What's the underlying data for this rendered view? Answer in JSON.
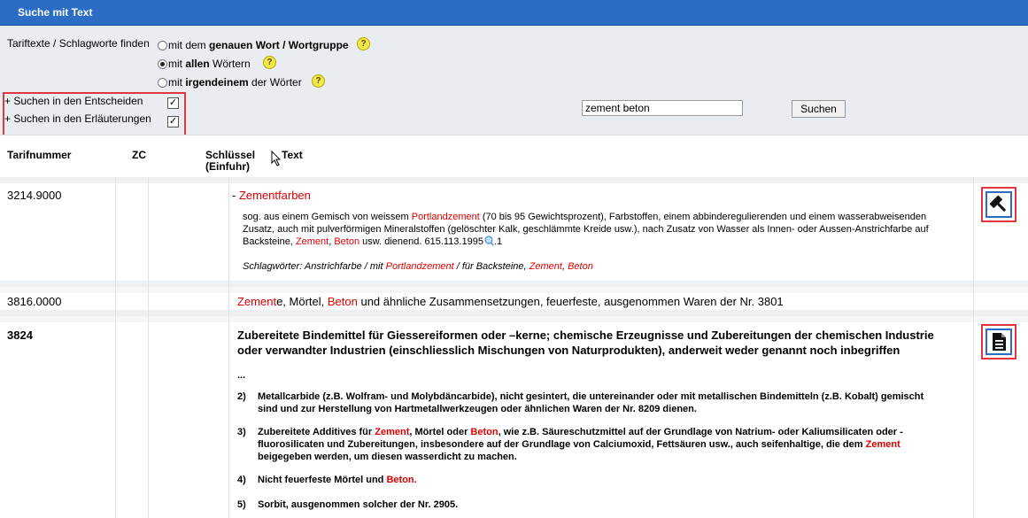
{
  "panel": {
    "title": "Suche mit Text"
  },
  "search": {
    "find_label": "Tariftexte / Schlagworte finden",
    "opt1_pre": "mit dem ",
    "opt1_bold": "genauen Wort / Wortgruppe",
    "opt2_pre": "mit ",
    "opt2_bold": "allen",
    "opt2_post": " Wörtern",
    "opt3_pre": "mit ",
    "opt3_bold": "irgendeinem",
    "opt3_post": " der Wörter",
    "selected_option": 2,
    "help_glyph": "?",
    "entscheide_label": "+ Suchen in den Entscheiden",
    "erlaeuterungen_label": "+ Suchen in den Erläuterungen",
    "entscheide_checked": true,
    "erlaeuterungen_checked": true,
    "query": "zement beton",
    "button": "Suchen"
  },
  "columns": {
    "tarif": "Tarifnummer",
    "zc": "ZC",
    "schluessel": "Schlüssel",
    "einfuhr": "(Einfuhr)",
    "text": "Text"
  },
  "rows": [
    {
      "number": "3214.9000",
      "dash": "- ",
      "title": "Zementfarben",
      "p1": "sog. aus einem Gemisch von weissem ",
      "p1_hl": "Portlandzement",
      "p1_b": " (70 bis 95 Gewichtsprozent), Farbstoffen, einem abbinderegulierenden und einem wasserabweisenden",
      "p2": "Zusatz, auch mit pulverförmigen Mineralstoffen (gelöschter Kalk, geschlämmte Kreide usw.), nach Zusatz von Wasser als Innen- oder Aussen-Anstrichfarbe auf",
      "p3_a": "Backsteine, ",
      "p3_hl1": "Zement",
      "p3_b": ", ",
      "p3_hl2": "Beton",
      "p3_c": " usw. dienend.   615.113.1995",
      "p3_d": ".1",
      "kw_a": "Schlagwörter: Anstrichfarbe / mit ",
      "kw_hl1": "Portlandzement",
      "kw_b": " / für Backsteine, ",
      "kw_hl2": "Zement",
      "kw_c": ", ",
      "kw_hl3": "Beton",
      "icon": "gavel-icon"
    },
    {
      "number": "3816.0000",
      "hl1": "Zement",
      "t1": "e, Mörtel, ",
      "hl2": "Beton",
      "t2": " und ähnliche Zusammensetzungen, feuerfeste, ausgenommen Waren der Nr. 3801"
    },
    {
      "number": "3824",
      "title1": "Zubereitete Bindemittel für Giessereiformen oder –kerne; chemische Erzeugnisse und Zubereitungen der chemischen Industrie",
      "title2": "oder verwandter Industrien (einschliesslich Mischungen von Naturprodukten), anderweit weder genannt noch inbegriffen",
      "ellipsis": "...",
      "i2_num": "2)",
      "i2_l1": "Metallcarbide (z.B. Wolfram- und Molybdäncarbide), nicht gesintert, die untereinander oder mit metallischen Bindemitteln (z.B. Kobalt) gemischt",
      "i2_l2": "sind und zur Herstellung von Hartmetallwerkzeugen oder ähnlichen Waren der Nr. 8209 dienen.",
      "i3_num": "3)",
      "i3_a": "Zubereitete Additives für ",
      "i3_hl1": "Zement",
      "i3_b": ", Mörtel oder ",
      "i3_hl2": "Beton",
      "i3_c": ", wie z.B. Säureschutzmittel auf der Grundlage von Natrium- oder Kaliumsilicaten oder -",
      "i3_l2": "fluorosilicaten und Zubereitungen, insbesondere auf der Grundlage von Calciumoxid, Fettsäuren usw., auch seifenhaltige, die dem ",
      "i3_hl3": "Zement",
      "i3_l3": "beigegeben werden, um diesen wasserdicht zu machen.",
      "i4_num": "4)",
      "i4_a": "Nicht feuerfeste Mörtel und ",
      "i4_hl": "Beton",
      "i4_b": ".",
      "i5_num": "5)",
      "i5": "Sorbit, ausgenommen solcher der Nr. 2905.",
      "icon": "document-icon"
    }
  ],
  "colors": {
    "header_blue": "#2b6cc4",
    "highlight_red": "#e00000",
    "panel_gray": "#e9edf1",
    "callout_red": "#e0383e"
  }
}
